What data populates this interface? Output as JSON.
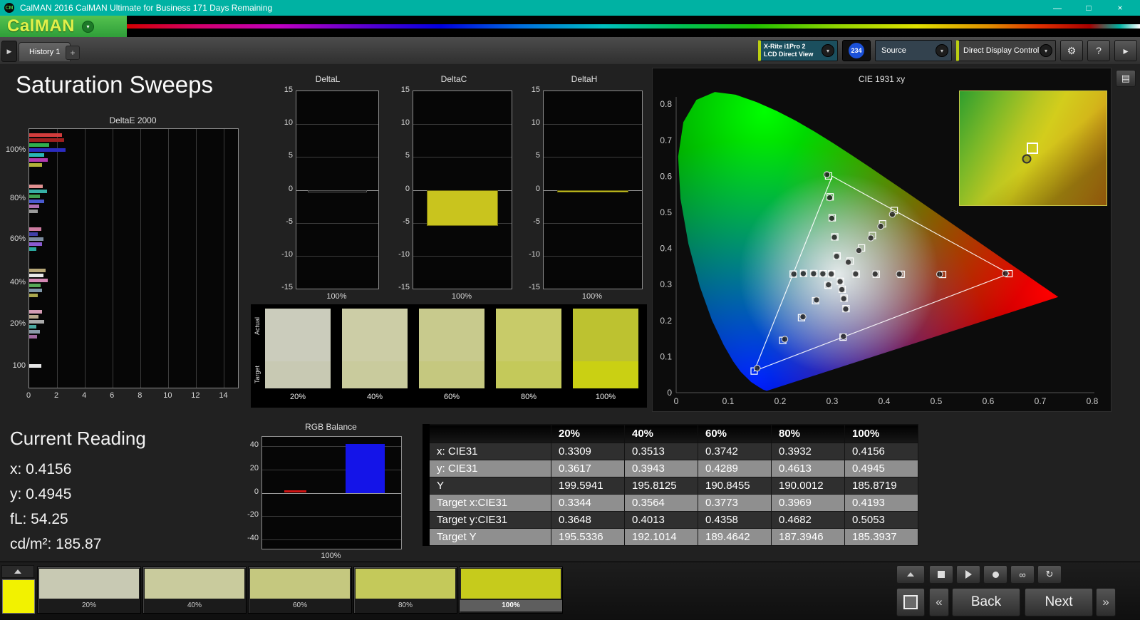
{
  "window": {
    "title": "CalMAN 2016 CalMAN Ultimate for Business 171 Days Remaining",
    "brand": "CalMAN",
    "titlebar_color": "#00b2a3"
  },
  "icons": {
    "logo_badge": "CM",
    "dropdown": "▾",
    "expand": "▶",
    "add_tab": "+",
    "gear": "⚙",
    "help": "?",
    "collapse": "▸",
    "minimize": "—",
    "maximize": "□",
    "close": "×",
    "loop": "∞",
    "refresh": "↻",
    "prev": "«",
    "next": "»",
    "panel": "▤"
  },
  "toolbar": {
    "history_tab": "History 1",
    "meter": {
      "line1": "X-Rite i1Pro 2",
      "line2": "LCD Direct View"
    },
    "badge": "234",
    "source": "Source",
    "display_control": "Direct Display Control"
  },
  "page": {
    "title": "Saturation Sweeps"
  },
  "current_reading": {
    "title": "Current Reading",
    "x": "x: 0.4156",
    "y": "y: 0.4945",
    "fl": "fL: 54.25",
    "cdm2": "cd/m²: 185.87"
  },
  "chart_data": [
    {
      "id": "deltae2000",
      "type": "bar",
      "orientation": "horizontal",
      "title": "DeltaE 2000",
      "xlim": [
        0,
        15
      ],
      "xticks": [
        0,
        2,
        4,
        6,
        8,
        10,
        12,
        14
      ],
      "groups": [
        {
          "label": "100%",
          "bars": [
            {
              "color": "#d23c3c",
              "value": 2.35
            },
            {
              "color": "#9e1f1f",
              "value": 2.5
            },
            {
              "color": "#2fae4e",
              "value": 1.45
            },
            {
              "color": "#2b2bc0",
              "value": 2.6
            },
            {
              "color": "#2ab6b6",
              "value": 1.1
            },
            {
              "color": "#b13ab1",
              "value": 1.35
            },
            {
              "color": "#b2b23a",
              "value": 0.9
            }
          ]
        },
        {
          "label": "80%",
          "bars": [
            {
              "color": "#e09090",
              "value": 0.95
            },
            {
              "color": "#36b0a6",
              "value": 1.3
            },
            {
              "color": "#3fa050",
              "value": 0.75
            },
            {
              "color": "#4a5ad0",
              "value": 1.05
            },
            {
              "color": "#b070b0",
              "value": 0.7
            },
            {
              "color": "#9a9a9a",
              "value": 0.6
            }
          ]
        },
        {
          "label": "60%",
          "bars": [
            {
              "color": "#cc7ba0",
              "value": 0.85
            },
            {
              "color": "#4040a8",
              "value": 0.6
            },
            {
              "color": "#7d8da0",
              "value": 1.0
            },
            {
              "color": "#8a5ad0",
              "value": 0.9
            },
            {
              "color": "#2aa89e",
              "value": 0.5
            }
          ]
        },
        {
          "label": "40%",
          "bars": [
            {
              "color": "#b8a878",
              "value": 1.2
            },
            {
              "color": "#e8e8e8",
              "value": 1.0
            },
            {
              "color": "#d489b4",
              "value": 1.35
            },
            {
              "color": "#57a857",
              "value": 0.8
            },
            {
              "color": "#8098a8",
              "value": 0.9
            },
            {
              "color": "#aaa84e",
              "value": 0.6
            }
          ]
        },
        {
          "label": "20%",
          "bars": [
            {
              "color": "#d49cb4",
              "value": 0.9
            },
            {
              "color": "#b8a88c",
              "value": 0.65
            },
            {
              "color": "#ababab",
              "value": 1.05
            },
            {
              "color": "#4aa8a0",
              "value": 0.5
            },
            {
              "color": "#8a9aa8",
              "value": 0.75
            },
            {
              "color": "#a06aa0",
              "value": 0.55
            }
          ]
        },
        {
          "label": "100",
          "bars": [
            {
              "color": "#e6e6e6",
              "value": 0.85
            }
          ]
        }
      ]
    },
    {
      "id": "deltaL",
      "type": "bar",
      "title": "DeltaL",
      "ylim": [
        -15,
        15
      ],
      "yticks": [
        15,
        10,
        5,
        0,
        -5,
        -10,
        -15
      ],
      "categories": [
        "100%"
      ],
      "values": [
        -0.2
      ],
      "bar_color": "#101010",
      "bar_border": "#5a5a5a"
    },
    {
      "id": "deltaC",
      "type": "bar",
      "title": "DeltaC",
      "ylim": [
        -15,
        15
      ],
      "yticks": [
        15,
        10,
        5,
        0,
        -5,
        -10,
        -15
      ],
      "categories": [
        "100%"
      ],
      "values": [
        -5.5
      ],
      "bar_color": "#c9c41e",
      "bar_border": "#6e690e"
    },
    {
      "id": "deltaH",
      "type": "bar",
      "title": "DeltaH",
      "ylim": [
        -15,
        15
      ],
      "yticks": [
        15,
        10,
        5,
        0,
        -5,
        -10,
        -15
      ],
      "categories": [
        "100%"
      ],
      "values": [
        -0.35
      ],
      "bar_color": "#c9c41e",
      "bar_border": "#6e690e"
    },
    {
      "id": "rgb_balance",
      "type": "bar",
      "title": "RGB Balance",
      "ylim": [
        -48,
        48
      ],
      "yticks": [
        40,
        20,
        0,
        -20,
        -40
      ],
      "categories": [
        "100%"
      ],
      "series": [
        {
          "name": "Red",
          "value": 2,
          "color": "#d01414"
        },
        {
          "name": "Green",
          "value": 0,
          "color": "#12a812"
        },
        {
          "name": "Blue",
          "value": 42,
          "color": "#1414e8"
        }
      ]
    },
    {
      "id": "cie1931",
      "type": "scatter",
      "title": "CIE 1931 xy",
      "xlim": [
        0,
        0.8
      ],
      "ylim": [
        0,
        0.8
      ],
      "xticks": [
        0,
        0.1,
        0.2,
        0.3,
        0.4,
        0.5,
        0.6,
        0.7,
        0.8
      ],
      "yticks": [
        0,
        0.1,
        0.2,
        0.3,
        0.4,
        0.5,
        0.6,
        0.7,
        0.8
      ],
      "gamut_triangle": [
        [
          0.64,
          0.33
        ],
        [
          0.3,
          0.6
        ],
        [
          0.15,
          0.06
        ]
      ],
      "white_point": [
        0.3127,
        0.329
      ],
      "sweeps": [
        {
          "name": "red",
          "targets": [
            [
              0.3461,
              0.3289
            ],
            [
              0.3846,
              0.3286
            ],
            [
              0.4325,
              0.3283
            ],
            [
              0.5123,
              0.3279
            ],
            [
              0.64,
              0.33
            ]
          ],
          "measured": [
            [
              0.345,
              0.3292
            ],
            [
              0.3825,
              0.329
            ],
            [
              0.429,
              0.3288
            ],
            [
              0.5065,
              0.3284
            ],
            [
              0.633,
              0.3305
            ]
          ]
        },
        {
          "name": "green",
          "targets": [
            [
              0.3093,
              0.379
            ],
            [
              0.305,
              0.432
            ],
            [
              0.3,
              0.485
            ],
            [
              0.296,
              0.543
            ],
            [
              0.293,
              0.601
            ]
          ],
          "measured": [
            [
              0.3085,
              0.3782
            ],
            [
              0.3042,
              0.4308
            ],
            [
              0.2992,
              0.4835
            ],
            [
              0.2952,
              0.5405
            ],
            [
              0.2898,
              0.6048
            ]
          ]
        },
        {
          "name": "blue",
          "targets": [
            [
              0.292,
              0.298
            ],
            [
              0.268,
              0.255
            ],
            [
              0.241,
              0.208
            ],
            [
              0.205,
              0.145
            ],
            [
              0.15,
              0.06
            ]
          ],
          "measured": [
            [
              0.2928,
              0.2992
            ],
            [
              0.2698,
              0.2572
            ],
            [
              0.2438,
              0.2104
            ],
            [
              0.2088,
              0.1482
            ],
            [
              0.1558,
              0.0678
            ]
          ]
        },
        {
          "name": "cyan",
          "targets": [
            [
              0.2988,
              0.3294
            ],
            [
              0.2826,
              0.3299
            ],
            [
              0.2648,
              0.3304
            ],
            [
              0.245,
              0.3308
            ],
            [
              0.225,
              0.329
            ]
          ],
          "measured": [
            [
              0.2982,
              0.3292
            ],
            [
              0.282,
              0.3296
            ],
            [
              0.2642,
              0.33
            ],
            [
              0.2444,
              0.3302
            ],
            [
              0.2262,
              0.3288
            ]
          ]
        },
        {
          "name": "magenta",
          "targets": [
            [
              0.3158,
              0.3088
            ],
            [
              0.3192,
              0.2868
            ],
            [
              0.3228,
              0.262
            ],
            [
              0.3266,
              0.233
            ],
            [
              0.321,
              0.154
            ]
          ],
          "measured": [
            [
              0.3152,
              0.308
            ],
            [
              0.3186,
              0.2858
            ],
            [
              0.3222,
              0.2608
            ],
            [
              0.326,
              0.2318
            ],
            [
              0.3216,
              0.1558
            ]
          ]
        },
        {
          "name": "yellow",
          "targets": [
            [
              0.3344,
              0.3648
            ],
            [
              0.3564,
              0.4013
            ],
            [
              0.3773,
              0.4358
            ],
            [
              0.3969,
              0.4682
            ],
            [
              0.4193,
              0.5053
            ]
          ],
          "measured": [
            [
              0.3309,
              0.3617
            ],
            [
              0.3513,
              0.3943
            ],
            [
              0.3742,
              0.4289
            ],
            [
              0.3932,
              0.4613
            ],
            [
              0.4156,
              0.4945
            ]
          ]
        }
      ],
      "inset": {
        "target": [
          0.4193,
          0.5053
        ],
        "measured": [
          0.4156,
          0.4945
        ],
        "range": {
          "x": [
            0.37,
            0.47
          ],
          "y": [
            0.45,
            0.56
          ]
        }
      }
    }
  ],
  "swatch_panel": {
    "row_labels": {
      "actual": "Actual",
      "target": "Target"
    },
    "swatches": [
      {
        "label": "20%",
        "actual": "#cbccbc",
        "target": "#c8c9b3"
      },
      {
        "label": "40%",
        "actual": "#cccda6",
        "target": "#c9cb9d"
      },
      {
        "label": "60%",
        "actual": "#c8ca8d",
        "target": "#c5c87f"
      },
      {
        "label": "80%",
        "actual": "#c8cb69",
        "target": "#c4c95a"
      },
      {
        "label": "100%",
        "actual": "#bdc230",
        "target": "#cad013"
      }
    ]
  },
  "table": {
    "columns": [
      "",
      "20%",
      "40%",
      "60%",
      "80%",
      "100%"
    ],
    "rows": [
      {
        "label": "x: CIE31",
        "values": [
          "0.3309",
          "0.3513",
          "0.3742",
          "0.3932",
          "0.4156"
        ]
      },
      {
        "label": "y: CIE31",
        "values": [
          "0.3617",
          "0.3943",
          "0.4289",
          "0.4613",
          "0.4945"
        ]
      },
      {
        "label": "Y",
        "values": [
          "199.5941",
          "195.8125",
          "190.8455",
          "190.0012",
          "185.8719"
        ]
      },
      {
        "label": "Target x:CIE31",
        "values": [
          "0.3344",
          "0.3564",
          "0.3773",
          "0.3969",
          "0.4193"
        ]
      },
      {
        "label": "Target y:CIE31",
        "values": [
          "0.3648",
          "0.4013",
          "0.4358",
          "0.4682",
          "0.5053"
        ]
      },
      {
        "label": "Target Y",
        "values": [
          "195.5336",
          "192.1014",
          "189.4642",
          "187.3946",
          "185.3937"
        ]
      }
    ]
  },
  "bottom": {
    "current_patch_color": "#f2f200",
    "patches": [
      {
        "label": "20%",
        "color": "#c8c9b3",
        "selected": false
      },
      {
        "label": "40%",
        "color": "#c9cb9d",
        "selected": false
      },
      {
        "label": "60%",
        "color": "#c5c87f",
        "selected": false
      },
      {
        "label": "80%",
        "color": "#c4c95a",
        "selected": false
      },
      {
        "label": "100%",
        "color": "#c6cb1c",
        "selected": true
      }
    ],
    "nav": {
      "back": "Back",
      "next": "Next"
    }
  }
}
